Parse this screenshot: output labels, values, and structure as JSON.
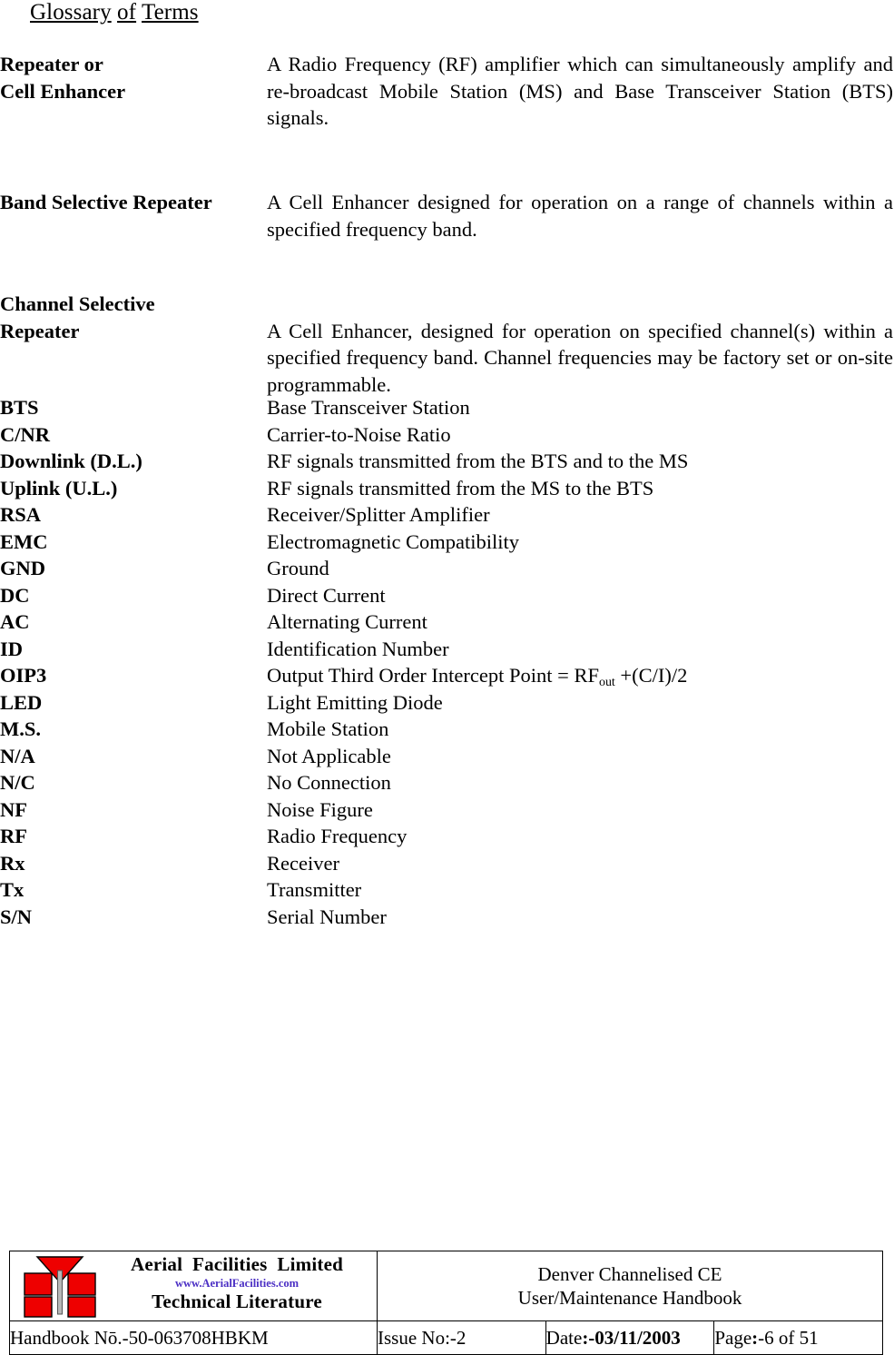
{
  "title": {
    "word1": "Glossary",
    "word2": "of",
    "word3": "Terms"
  },
  "definitions": [
    {
      "term": "Repeater or\nCell Enhancer",
      "body": "A Radio Frequency (RF) amplifier which can simultaneously amplify and re-broadcast Mobile Station (MS) and Base Transceiver Station (BTS) signals."
    },
    {
      "term": "Band Selective Repeater",
      "body": "A Cell Enhancer designed for operation on a range of channels within a specified frequency band."
    },
    {
      "term": "Channel Selective\nRepeater",
      "body": "A Cell Enhancer, designed for operation on specified channel(s) within a specified frequency band. Channel frequencies may be factory set or on-site programmable."
    }
  ],
  "abbreviations": [
    {
      "key": "BTS",
      "value": "Base Transceiver Station"
    },
    {
      "key": "C/NR",
      "value": "Carrier-to-Noise Ratio"
    },
    {
      "key": "Downlink (D.L.)",
      "value": "RF signals transmitted from the BTS and to the MS"
    },
    {
      "key": "Uplink (U.L.)",
      "value": "RF signals transmitted from the MS to the BTS"
    },
    {
      "key": "RSA",
      "value": "Receiver/Splitter Amplifier"
    },
    {
      "key": "EMC",
      "value": "Electromagnetic Compatibility"
    },
    {
      "key": "GND",
      "value": "Ground"
    },
    {
      "key": "DC",
      "value": "Direct Current"
    },
    {
      "key": "AC",
      "value": "Alternating Current"
    },
    {
      "key": "ID",
      "value": "Identification Number"
    },
    {
      "key": "OIP3",
      "value": "Output Third Order Intercept Point = RF",
      "value_sub": "out",
      "value_tail": " +(C/I)/2"
    },
    {
      "key": "LED",
      "value": "Light Emitting Diode"
    },
    {
      "key": "M.S.",
      "value": "Mobile Station"
    },
    {
      "key": "N/A",
      "value": "Not Applicable"
    },
    {
      "key": "N/C",
      "value": "No Connection"
    },
    {
      "key": "NF",
      "value": "Noise Figure"
    },
    {
      "key": "RF",
      "value": "Radio Frequency"
    },
    {
      "key": "Rx",
      "value": "Receiver"
    },
    {
      "key": "Tx",
      "value": "Transmitter"
    },
    {
      "key": "S/N",
      "value": "Serial Number"
    }
  ],
  "footer": {
    "logo": {
      "company": "Aerial  Facilities  Limited",
      "url": "www.AerialFacilities.com",
      "tagline": "Technical Literature",
      "mark_color": "#ee0000",
      "url_color": "#4b2fc4"
    },
    "document_title_line1": "Denver Channelised CE",
    "document_title_line2": "User/Maintenance Handbook",
    "handbook_label": "Handbook N",
    "handbook_number": "ō.-50-063708HBKM",
    "issue_label": "Issue No:-",
    "issue_value": "2",
    "date_label": "Date",
    "date_value": ":-03/11/2003",
    "page_label": "Page",
    "page_colon": ":",
    "page_value": "-6 of 51"
  }
}
